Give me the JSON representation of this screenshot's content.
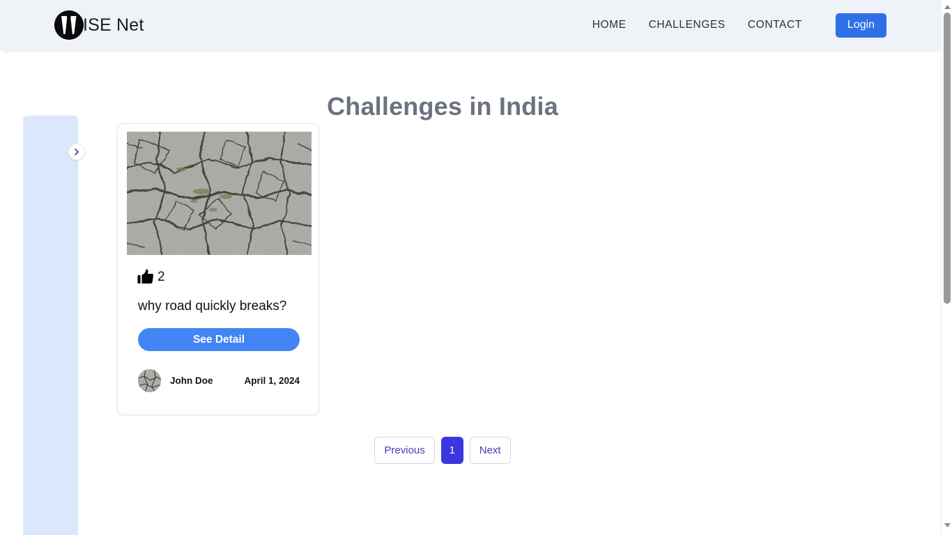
{
  "header": {
    "brand_name": "ISE Net",
    "logo_icon": "wise-net-logo-icon",
    "nav": [
      {
        "label": "HOME",
        "name": "nav-link-home"
      },
      {
        "label": "CHALLENGES",
        "name": "nav-link-challenges"
      },
      {
        "label": "CONTACT",
        "name": "nav-link-contact"
      }
    ],
    "login_label": "Login",
    "login_color": "#2f6fe8",
    "background_color": "#eff2f7"
  },
  "page": {
    "title": "Challenges in India",
    "title_color": "#6b7280"
  },
  "sidebar": {
    "background_color": "#dbe8fb",
    "toggle_icon": "chevron-right-icon"
  },
  "card": {
    "image_alt": "cracked-road-photo",
    "like_icon": "thumbs-up-icon",
    "like_count": "2",
    "title": "why road quickly breaks?",
    "detail_button_label": "See Detail",
    "detail_button_color": "#4285f4",
    "author": "John Doe",
    "date": "April 1, 2024"
  },
  "pagination": {
    "previous_label": "Previous",
    "next_label": "Next",
    "pages": [
      {
        "label": "1",
        "active": true
      }
    ],
    "active_color": "#3b37e0"
  },
  "scrollbar": {
    "up_icon": "scroll-up-arrow-icon",
    "down_icon": "scroll-down-arrow-icon"
  }
}
